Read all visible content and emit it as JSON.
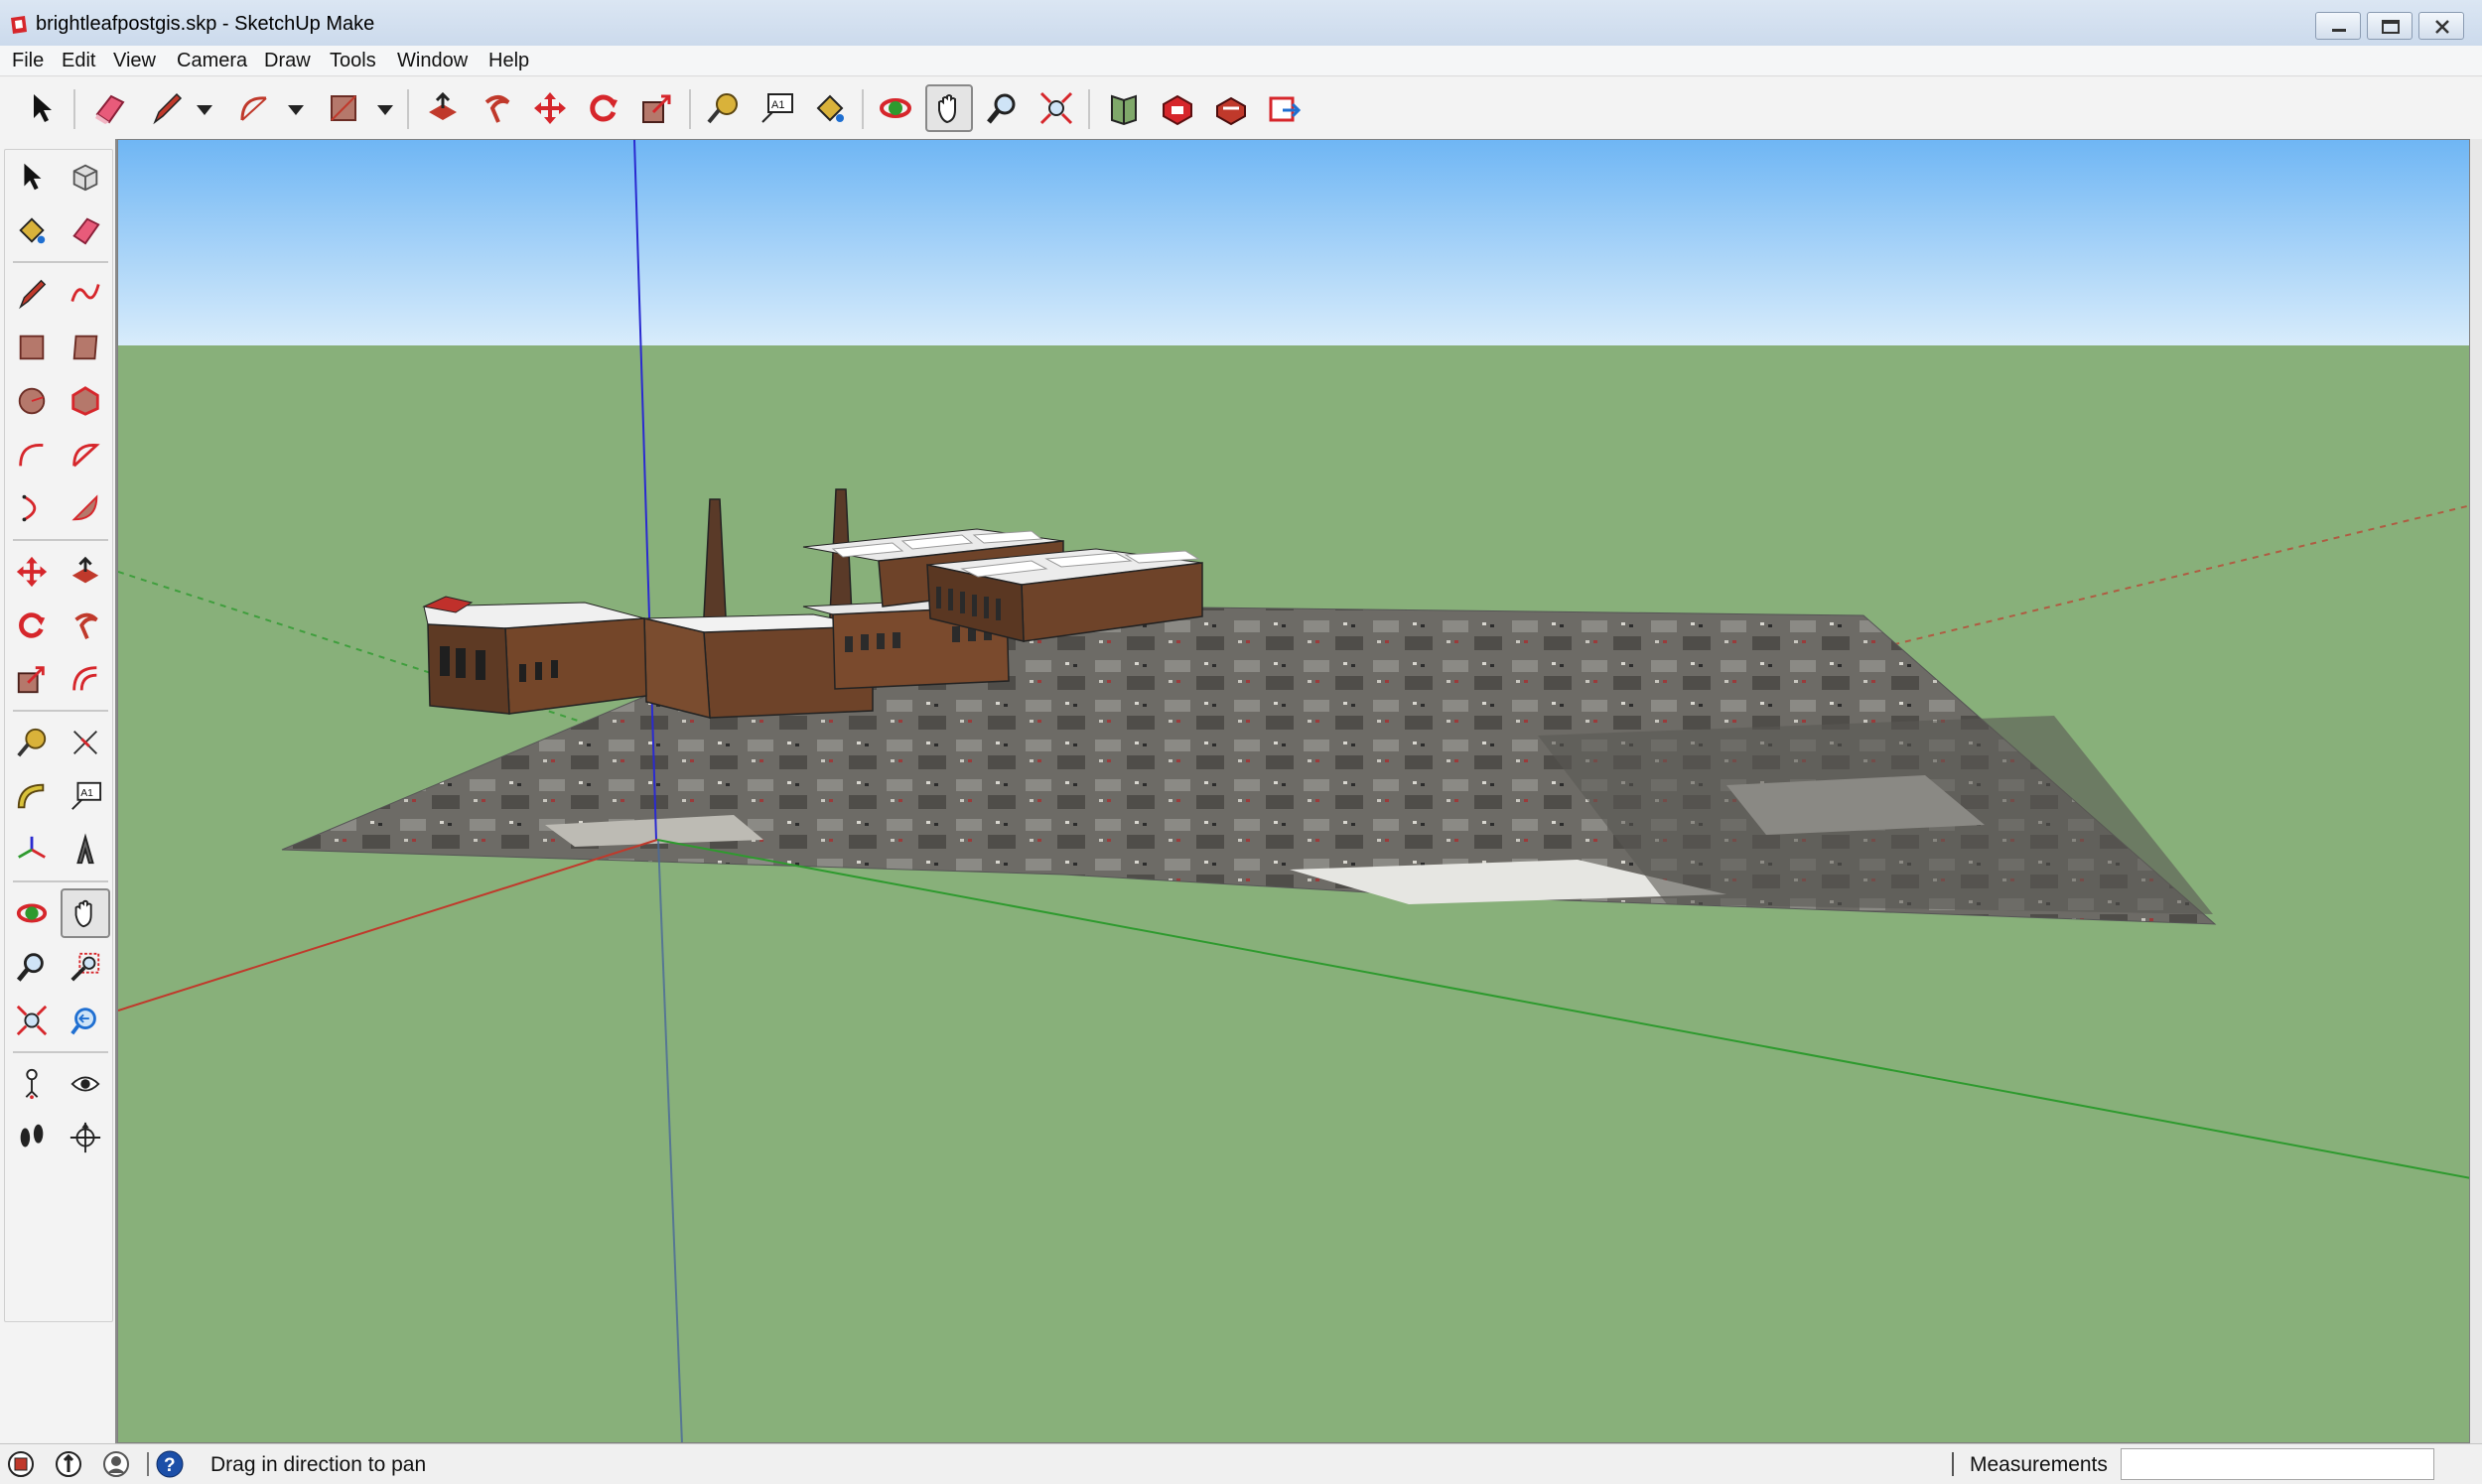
{
  "window": {
    "title": "brightleafpostgis.skp - SketchUp Make",
    "controls": [
      "minimize",
      "maximize",
      "close"
    ]
  },
  "menu": {
    "items": [
      "File",
      "Edit",
      "View",
      "Camera",
      "Draw",
      "Tools",
      "Window",
      "Help"
    ]
  },
  "toolbar": {
    "tools": [
      "select-icon",
      "eraser-icon",
      "pencil-icon",
      "arc-icon",
      "rectangle-icon",
      "push-pull-icon",
      "follow-me-icon",
      "move-icon",
      "rotate-icon",
      "scale-icon",
      "tape-measure-icon",
      "text-icon",
      "paint-bucket-icon",
      "orbit-icon",
      "pan-icon",
      "zoom-icon",
      "zoom-extents-icon",
      "add-location-icon",
      "3d-warehouse-icon",
      "extension-warehouse-icon",
      "share-model-icon"
    ],
    "active_tool": "pan-icon"
  },
  "left_toolbar": {
    "tools": [
      "select-icon",
      "make-component-icon",
      "paint-bucket-icon",
      "eraser-icon",
      "line-icon",
      "freehand-icon",
      "rectangle-icon",
      "rotated-rectangle-icon",
      "circle-icon",
      "polygon-icon",
      "arc-icon",
      "two-point-arc-icon",
      "three-point-arc-icon",
      "pie-icon",
      "move-icon",
      "push-pull-icon",
      "rotate-icon",
      "follow-me-icon",
      "scale-icon",
      "offset-icon",
      "tape-measure-icon",
      "dimension-icon",
      "protractor-icon",
      "text-icon",
      "axes-icon",
      "3d-text-icon",
      "orbit-icon",
      "pan-icon",
      "zoom-icon",
      "zoom-window-icon",
      "zoom-extents-icon",
      "previous-view-icon",
      "position-camera-icon",
      "look-around-icon",
      "walk-icon",
      "section-plane-icon"
    ],
    "active_tool": "pan-icon"
  },
  "viewport": {
    "sky_top_color": "#6fb6f4",
    "sky_bottom_color": "#d8ecfb",
    "ground_color": "#88b07a",
    "axis_red": "#c0392b",
    "axis_green": "#2e9a2e",
    "axis_blue": "#2a2ad0",
    "model_name": "brightleafpostgis"
  },
  "statusbar": {
    "icons": [
      "geo-location-icon",
      "credits-icon",
      "user-icon",
      "help-icon"
    ],
    "message": "Drag in direction to pan",
    "measurements_label": "Measurements",
    "measurements_value": ""
  }
}
